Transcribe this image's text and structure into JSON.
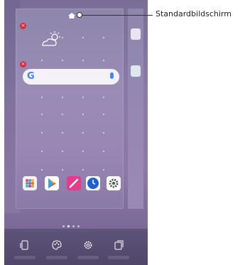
{
  "callout": {
    "label": "Standardbildschirm"
  },
  "home_screen": {
    "search_bar": {
      "logo": "G",
      "mic": "mic-icon"
    },
    "dock_apps": [
      "app-folder-icon",
      "play-store-icon",
      "notes-icon",
      "clock-icon",
      "settings-icon"
    ],
    "page_indicator_count": 4,
    "active_page": 2
  },
  "bottom_bar": {
    "icons": [
      "wallpaper-icon",
      "theme-icon",
      "settings-icon",
      "widgets-icon"
    ]
  },
  "colors": {
    "remove_badge": "#e0263a",
    "google_blue": "#4285f4",
    "notes_pink": "#e83a8c"
  }
}
